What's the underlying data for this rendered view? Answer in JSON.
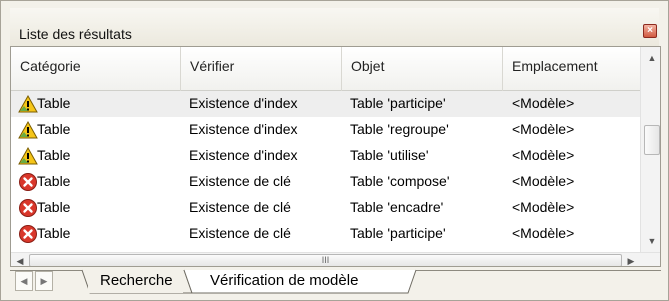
{
  "panel": {
    "title": "Liste des résultats",
    "close_glyph": "×"
  },
  "columns": [
    "Catégorie",
    "Vérifier",
    "Objet",
    "Emplacement"
  ],
  "rows": [
    {
      "icon": "warning-icon",
      "categorie": "Table",
      "verifier": "Existence d'index",
      "objet": "Table 'participe'",
      "emplacement": "<Modèle>",
      "selected": true
    },
    {
      "icon": "warning-icon",
      "categorie": "Table",
      "verifier": "Existence d'index",
      "objet": "Table 'regroupe'",
      "emplacement": "<Modèle>",
      "selected": false
    },
    {
      "icon": "warning-icon",
      "categorie": "Table",
      "verifier": "Existence d'index",
      "objet": "Table 'utilise'",
      "emplacement": "<Modèle>",
      "selected": false
    },
    {
      "icon": "error-icon",
      "categorie": "Table",
      "verifier": "Existence de clé",
      "objet": "Table 'compose'",
      "emplacement": "<Modèle>",
      "selected": false
    },
    {
      "icon": "error-icon",
      "categorie": "Table",
      "verifier": "Existence de clé",
      "objet": "Table 'encadre'",
      "emplacement": "<Modèle>",
      "selected": false
    },
    {
      "icon": "error-icon",
      "categorie": "Table",
      "verifier": "Existence de clé",
      "objet": "Table 'participe'",
      "emplacement": "<Modèle>",
      "selected": false
    }
  ],
  "tabs": [
    {
      "label": "Recherche",
      "active": false
    },
    {
      "label": "Vérification de modèle",
      "active": true
    }
  ],
  "scroll": {
    "grip": "III",
    "up": "▲",
    "down": "▼",
    "left": "◀",
    "right": "▶"
  },
  "colors": {
    "warning": "#f5c518",
    "error": "#d9372b",
    "selected_row": "#eeeeee"
  }
}
